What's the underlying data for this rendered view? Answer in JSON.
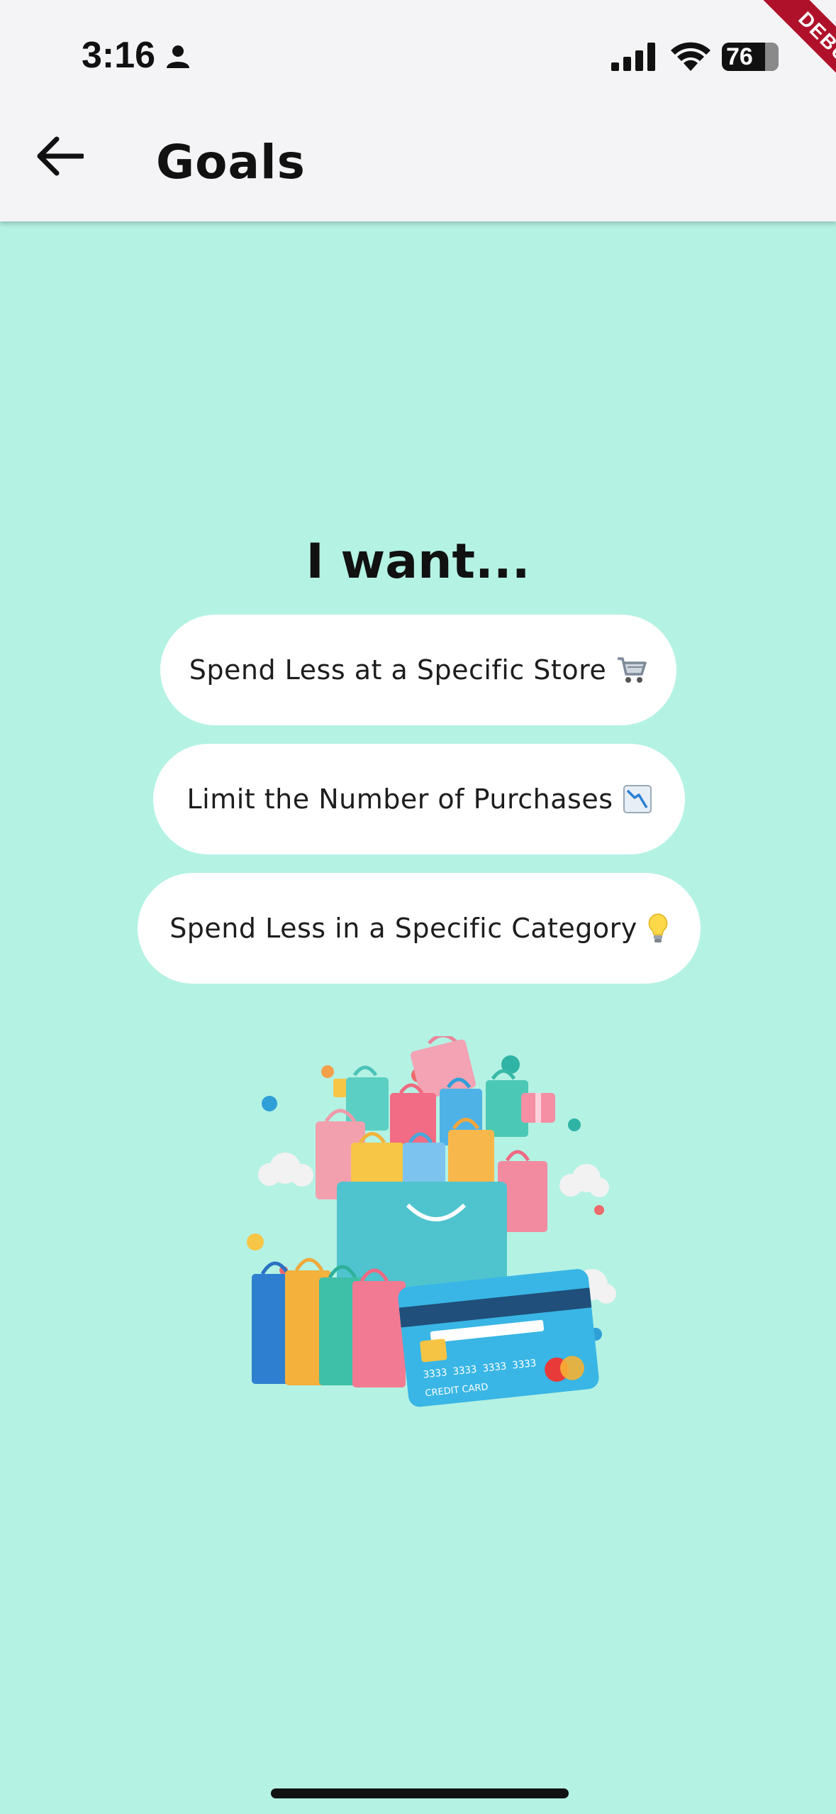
{
  "status_bar": {
    "time": "3:16",
    "battery_level": "76",
    "battery_percent": 76,
    "icons": [
      "person-icon",
      "signal-icon",
      "wifi-icon",
      "battery-icon"
    ]
  },
  "debug_banner": "DEBUG",
  "app_bar": {
    "title": "Goals",
    "back_icon": "arrow-left-icon"
  },
  "main": {
    "heading": "I want...",
    "options": [
      {
        "label": "Spend Less at a Specific Store",
        "emoji": "🛒",
        "icon": "shopping-cart-icon"
      },
      {
        "label": "Limit the Number of Purchases",
        "emoji": "📉",
        "icon": "chart-decreasing-icon"
      },
      {
        "label": "Spend Less in a Specific Category",
        "emoji": "💡",
        "icon": "light-bulb-icon"
      }
    ],
    "illustration": {
      "description_icon": "shopping-bags-credit-card-illustration",
      "card_text": "CREDIT CARD",
      "card_numbers": "3333 3333 3333 3333"
    }
  },
  "colors": {
    "background": "#b4f2e4",
    "app_bar": "#f4f4f6",
    "button": "#ffffff",
    "debug": "#b0112a"
  }
}
